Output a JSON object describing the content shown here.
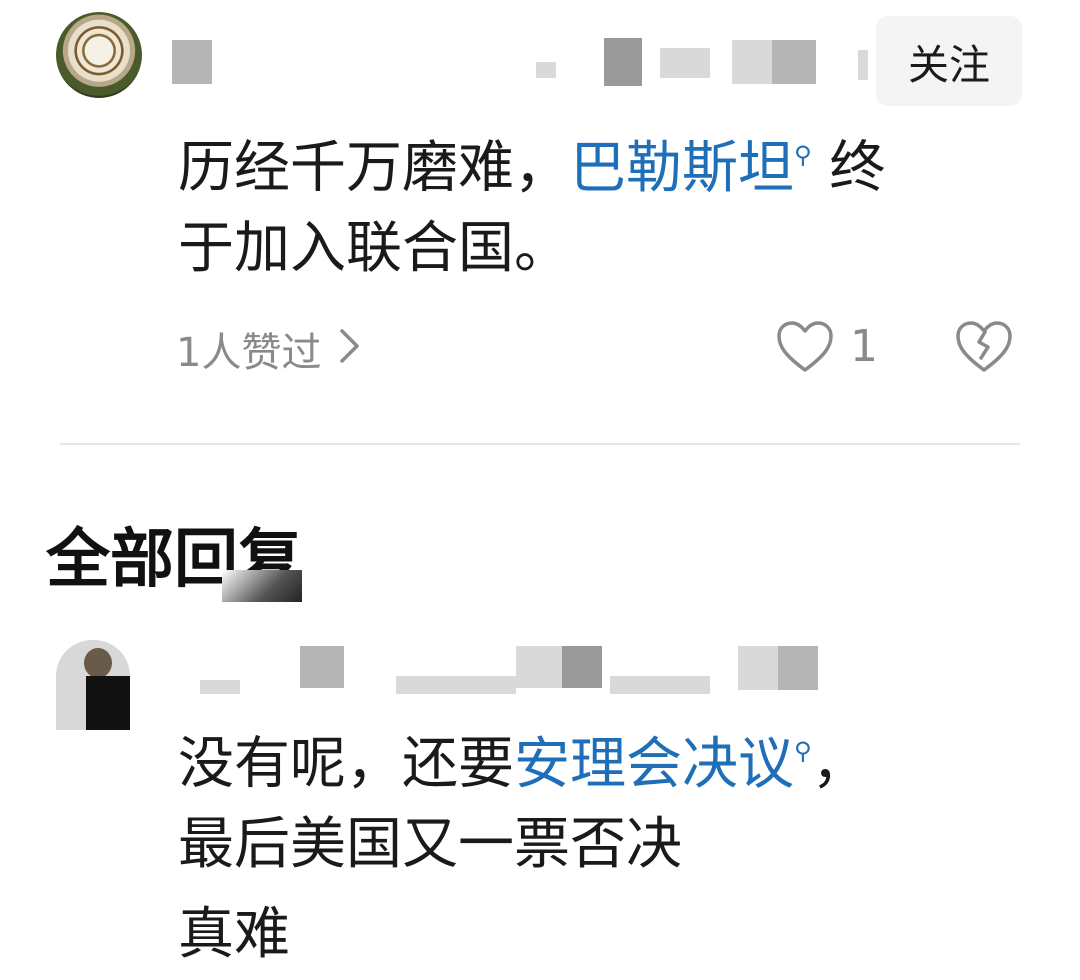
{
  "comment": {
    "follow_label": "关注",
    "text_line1_before": "历经千万磨难，",
    "text_link": "巴勒斯坦",
    "text_line1_after": " 终",
    "text_line2": "于加入联合国。",
    "likes_summary": "1人赞过",
    "like_count": "1"
  },
  "replies": {
    "section_title": "全部回复",
    "reply1": {
      "line1_before": "没有呢，还要",
      "line1_link": "安理会决议",
      "line1_after": "，",
      "line2": "最后美国又一票否决",
      "line3": "真难"
    }
  },
  "icons": {
    "search_sup": "search-icon",
    "like": "heart-outline-icon",
    "dislike": "broken-heart-icon",
    "chevron": "chevron-right-icon"
  },
  "colors": {
    "link": "#1f6fb8",
    "secondary_text": "#8a8a8a",
    "follow_bg": "#f4f4f4"
  }
}
